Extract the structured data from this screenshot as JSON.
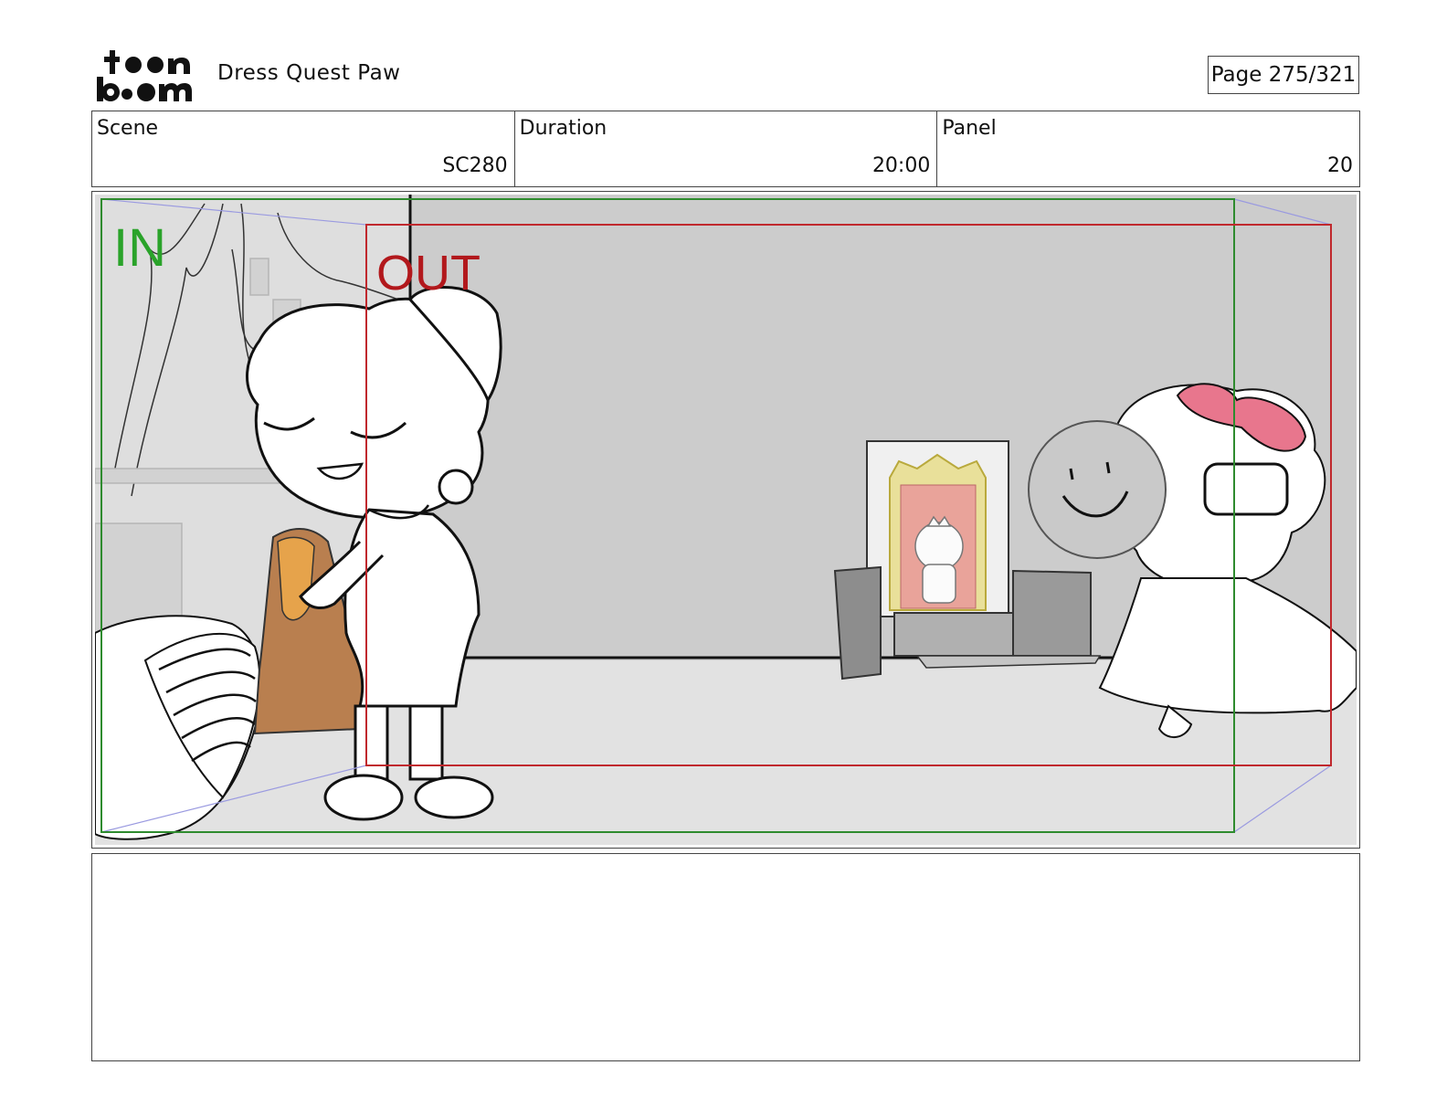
{
  "header": {
    "logo_text": "toon boom",
    "project_title": "Dress Quest Paw",
    "page_indicator": "Page 275/321"
  },
  "info": {
    "scene_label": "Scene",
    "scene_value": "SC280",
    "duration_label": "Duration",
    "duration_value": "20:00",
    "panel_label": "Panel",
    "panel_value": "20"
  },
  "panel": {
    "in_label": "IN",
    "out_label": "OUT",
    "colors": {
      "in_frame": "#2e8b2e",
      "out_frame": "#c0282d",
      "wall": "#cccccc",
      "floor": "#e2e2e2"
    }
  },
  "notes": {
    "text": ""
  }
}
